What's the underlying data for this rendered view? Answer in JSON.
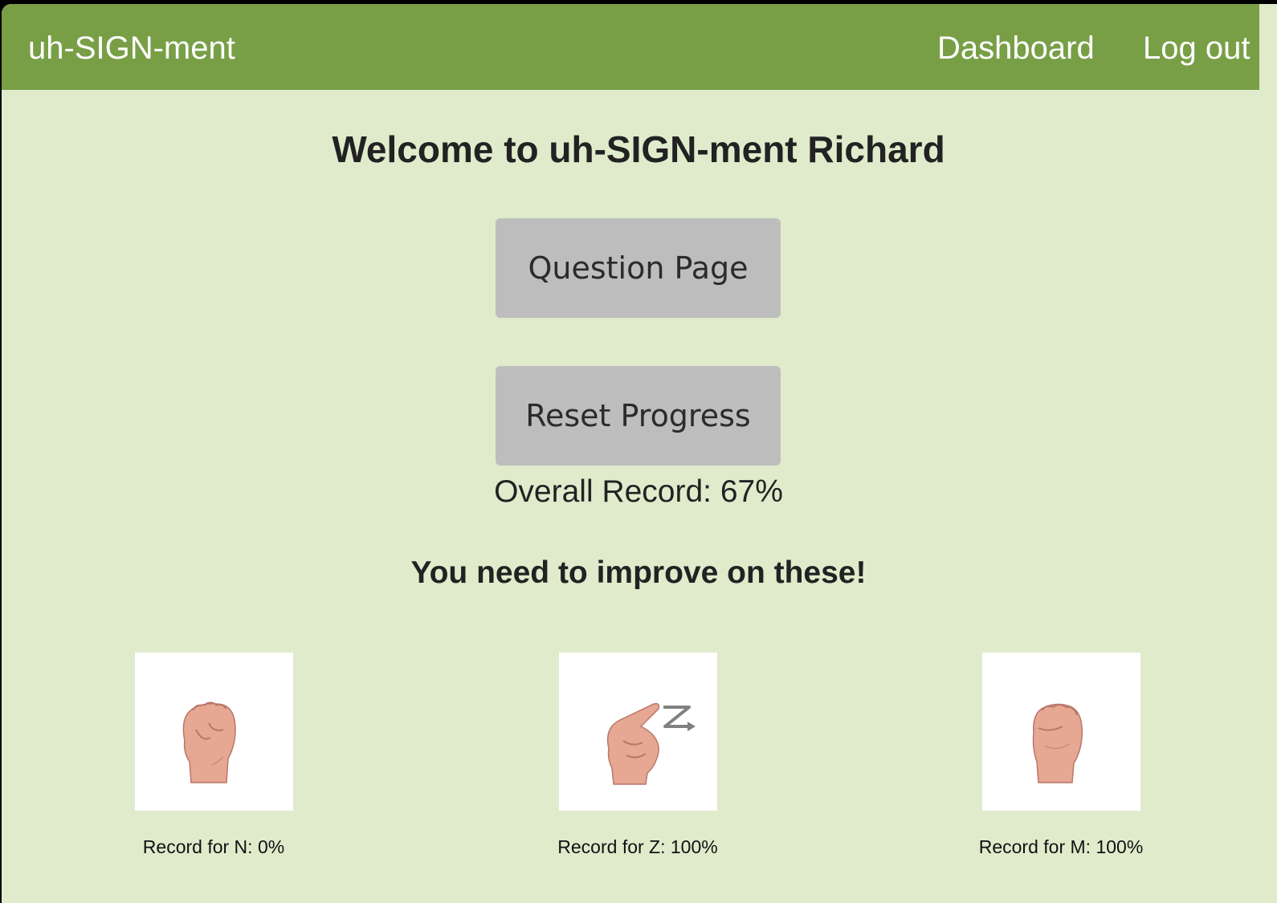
{
  "navbar": {
    "brand": "uh-SIGN-ment",
    "links": [
      {
        "label": "Dashboard"
      },
      {
        "label": "Log out"
      }
    ],
    "color": "#789f46"
  },
  "main": {
    "welcome": "Welcome to uh-SIGN-ment Richard",
    "question_button": "Question Page",
    "reset_button": "Reset Progress",
    "overall_record": "Overall Record: 67%",
    "improve_heading": "You need to improve on these!",
    "background": "#e0ebcc"
  },
  "cards": [
    {
      "letter": "N",
      "icon": "asl-letter-n-hand",
      "label": "Record for N: 0%"
    },
    {
      "letter": "Z",
      "icon": "asl-letter-z-hand",
      "label": "Record for Z: 100%"
    },
    {
      "letter": "M",
      "icon": "asl-letter-m-hand",
      "label": "Record for M: 100%"
    }
  ]
}
